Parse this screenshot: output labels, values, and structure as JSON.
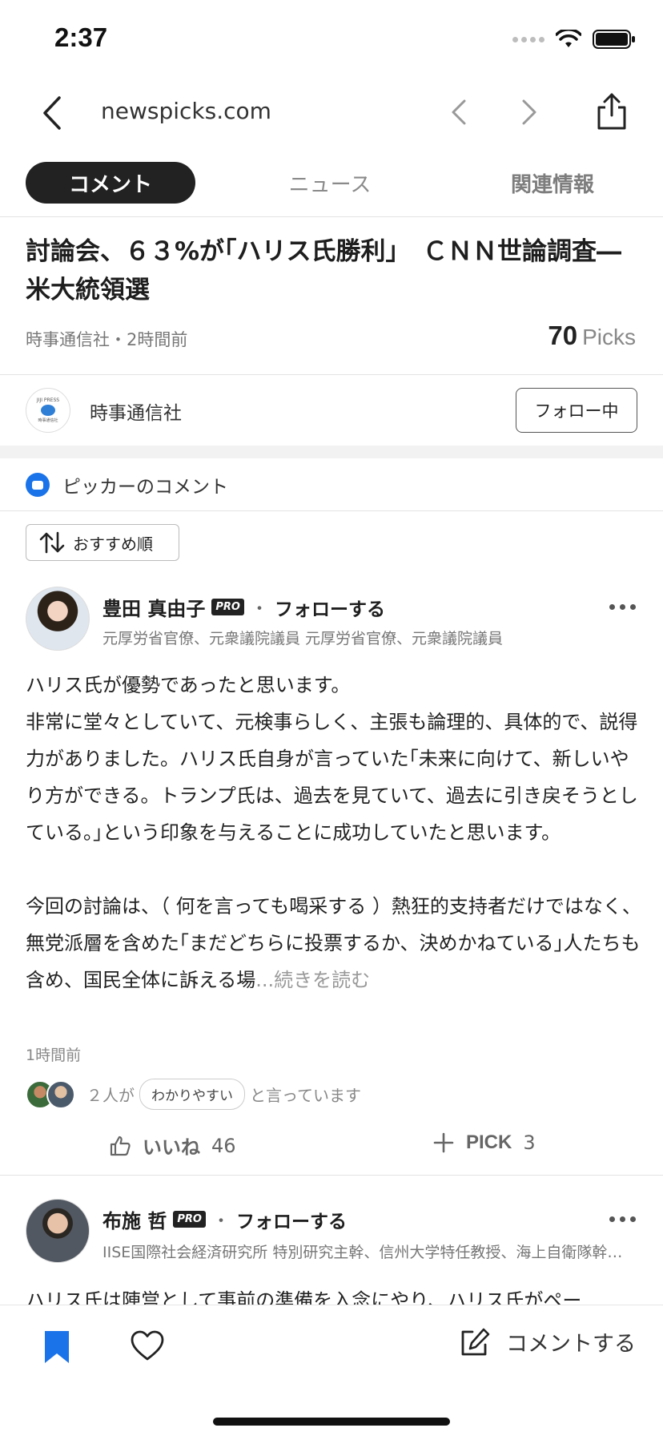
{
  "status": {
    "time": "2:37"
  },
  "nav": {
    "url": "newspicks.com"
  },
  "tabs": [
    "コメント",
    "ニュース",
    "関連情報"
  ],
  "article": {
    "title": "討論会、６３%が｢ハリス氏勝利｣　ＣＮＮ世論調査―米大統領選",
    "meta": "時事通信社・2時間前",
    "picks_count": "70",
    "picks_label": "Picks"
  },
  "publisher": {
    "logo_top": "JIJI PRESS",
    "logo_bottom": "時事通信社",
    "name": "時事通信社",
    "follow_label": "フォロー中"
  },
  "pickers": {
    "title": "ピッカーのコメント",
    "sort_label": "おすすめ順"
  },
  "comment1": {
    "name": "豊田 真由子",
    "pro": "PRO",
    "dot": "・",
    "follow": "フォローする",
    "role": "元厚労省官僚、元衆議院議員 元厚労省官僚、元衆議院議員",
    "p1": "ハリス氏が優勢であったと思います。",
    "p2": "非常に堂々としていて、元検事らしく、主張も論理的、具体的で、説得力がありました。ハリス氏自身が言っていた｢未来に向けて、新しいやり方ができる。トランプ氏は、過去を見ていて、過去に引き戻そうとしている。｣という印象を与えることに成功していたと思います。",
    "p3": "今回の討論は、（ 何を言っても喝采する ）熱狂的支持者だけではなく、無党派層を含めた｢まだどちらに投票するか、決めかねている｣人たちも含め、国民全体に訴える場",
    "read_more": "...続きを読む",
    "time": "1時間前",
    "react_prefix": "２人が",
    "react_tag": "わかりやすい",
    "react_suffix": "と言っています",
    "like_label": "いいね",
    "like_count": "46",
    "pick_label": "PICK",
    "pick_count": "3"
  },
  "comment2": {
    "name": "布施 哲",
    "pro": "PRO",
    "dot": "・",
    "follow": "フォローする",
    "role": "IISE国際社会経済研究所 特別研究主幹、信州大学特任教授、海上自衛隊幹部学校",
    "body": "ハリス氏は陣営として事前の準備を入念にやり、ハリス氏がペー"
  },
  "bottom": {
    "comment_label": "コメントする"
  },
  "colors": {
    "accent": "#1a73e8",
    "tab_active_bg": "#222222"
  }
}
